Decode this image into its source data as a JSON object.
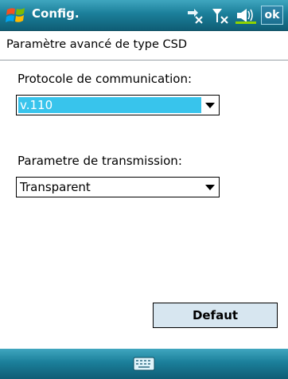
{
  "titlebar": {
    "title": "Config.",
    "ok_label": "ok",
    "icons": [
      "windows-start-icon",
      "connectivity-icon",
      "signal-off-icon",
      "speaker-icon"
    ]
  },
  "subheader": {
    "text": "Paramètre avancé de type CSD"
  },
  "protocol": {
    "label": "Protocole de communication:",
    "value": "v.110"
  },
  "transmission": {
    "label": "Parametre de transmission:",
    "value": "Transparent"
  },
  "defaut_button": {
    "label": "Defaut"
  },
  "bottombar": {
    "icon": "keyboard-icon"
  },
  "colors": {
    "titlebar": "#1b7f9a",
    "selection": "#38c4ec",
    "button_bg": "#d7e6f0"
  }
}
